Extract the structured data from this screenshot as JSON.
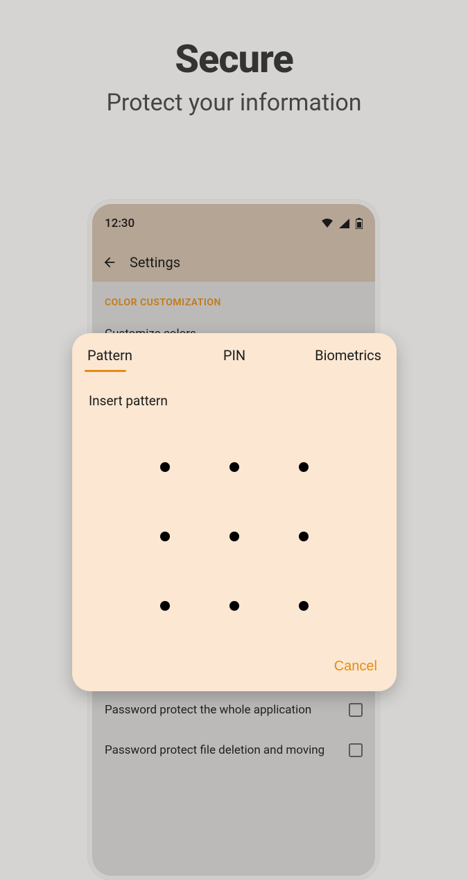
{
  "promo": {
    "title": "Secure",
    "subtitle": "Protect your information"
  },
  "statusbar": {
    "time": "12:30"
  },
  "appbar": {
    "title": "Settings"
  },
  "settings": {
    "section_color": "COLOR CUSTOMIZATION",
    "customize_colors": "Customize colors",
    "protect_whole_app": "Password protect the whole application",
    "protect_deletion": "Password protect file deletion and moving"
  },
  "dialog": {
    "tabs": {
      "pattern": "Pattern",
      "pin": "PIN",
      "biometrics": "Biometrics"
    },
    "instruction": "Insert pattern",
    "cancel": "Cancel"
  },
  "colors": {
    "accent": "#e78b14",
    "dialog_bg": "#fbe7d2"
  }
}
